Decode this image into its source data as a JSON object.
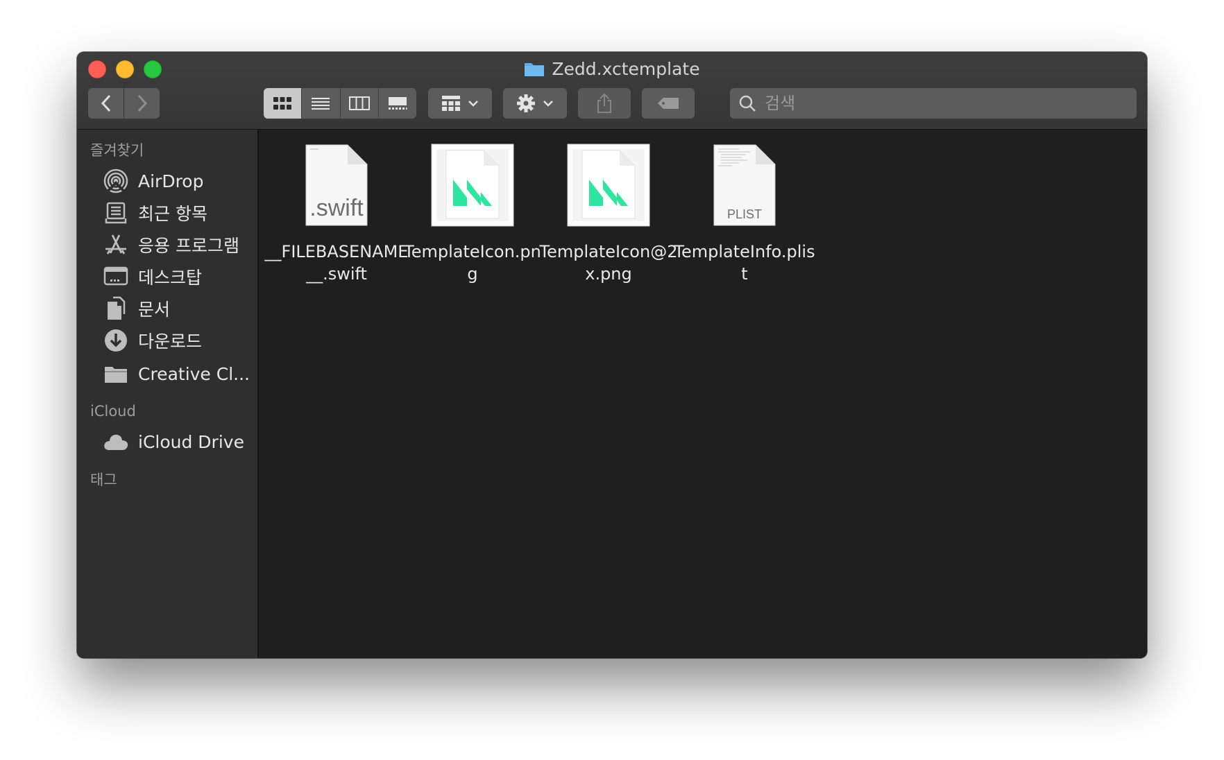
{
  "window": {
    "title": "Zedd.xctemplate"
  },
  "toolbar": {
    "back_icon": "chevron-left-icon",
    "forward_icon": "chevron-right-icon",
    "view_modes": [
      "icon-view",
      "list-view",
      "column-view",
      "gallery-view"
    ],
    "active_view": "icon-view",
    "search": {
      "placeholder": "검색",
      "value": ""
    }
  },
  "sidebar": {
    "favorites_header": "즐겨찾기",
    "favorites": [
      {
        "label": "AirDrop",
        "icon": "airdrop-icon"
      },
      {
        "label": "최근 항목",
        "icon": "recents-icon"
      },
      {
        "label": "응용 프로그램",
        "icon": "applications-icon"
      },
      {
        "label": "데스크탑",
        "icon": "desktop-icon"
      },
      {
        "label": "문서",
        "icon": "documents-icon"
      },
      {
        "label": "다운로드",
        "icon": "downloads-icon"
      },
      {
        "label": "Creative Cl...",
        "icon": "folder-icon"
      }
    ],
    "icloud_header": "iCloud",
    "icloud": [
      {
        "label": "iCloud Drive",
        "icon": "cloud-icon"
      }
    ],
    "tags_header": "태그"
  },
  "files": [
    {
      "name": "__FILEBASENAME__.swift",
      "kind": "swift",
      "icon_text": ".swift"
    },
    {
      "name": "TemplateIcon.png",
      "kind": "png"
    },
    {
      "name": "TemplateIcon@2x.png",
      "kind": "png"
    },
    {
      "name": "TemplateInfo.plist",
      "kind": "plist",
      "icon_text": "PLIST"
    }
  ],
  "colors": {
    "window_bg": "#1f1f20",
    "sidebar_bg": "#2f2f2f",
    "toolbar_bg": "#3a3a3a",
    "accent_green": "#2ee59d",
    "folder_blue": "#5aaee8"
  }
}
